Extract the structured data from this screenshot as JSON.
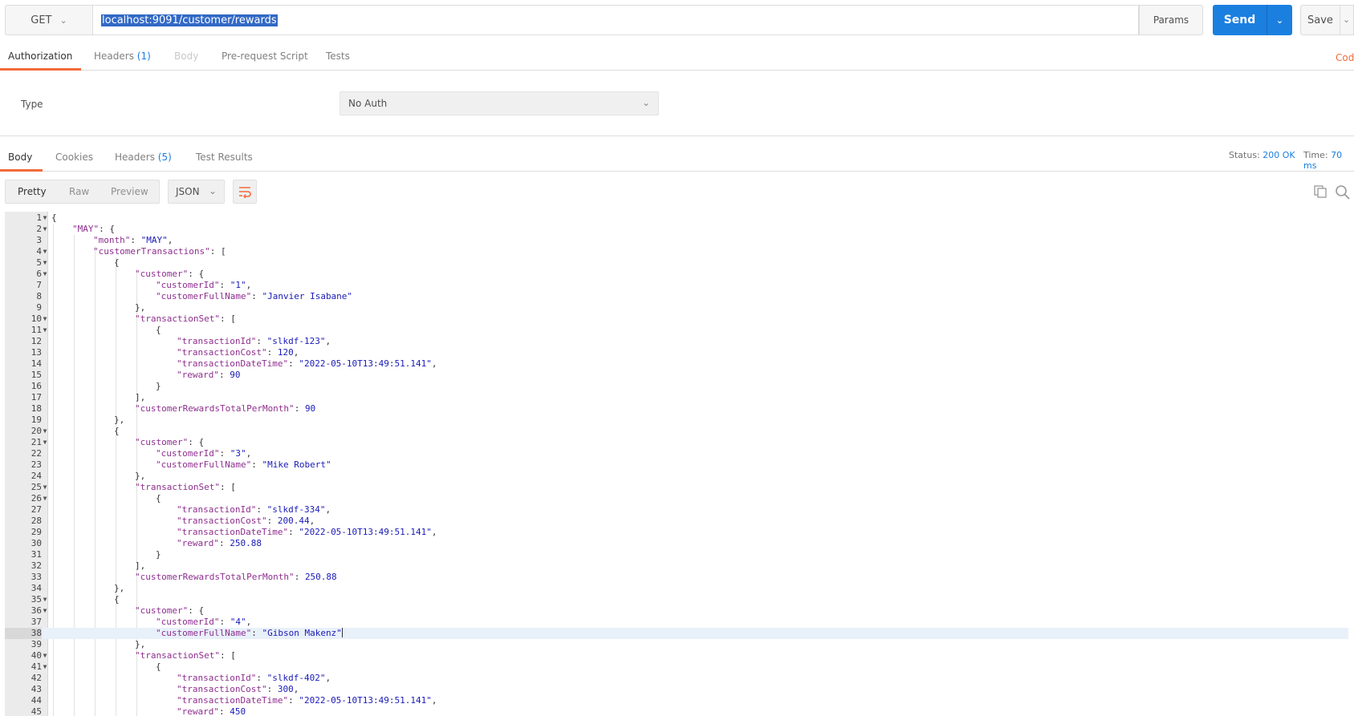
{
  "request": {
    "method": "GET",
    "url": "localhost:9091/customer/rewards",
    "params_label": "Params",
    "send_label": "Send",
    "save_label": "Save"
  },
  "request_tabs": [
    {
      "label": "Authorization",
      "count": ""
    },
    {
      "label": "Headers",
      "count": "(1)"
    },
    {
      "label": "Body",
      "count": ""
    },
    {
      "label": "Pre-request Script",
      "count": ""
    },
    {
      "label": "Tests",
      "count": ""
    }
  ],
  "code_link": "Cod",
  "auth": {
    "type_label": "Type",
    "type_value": "No Auth"
  },
  "response_tabs": [
    {
      "label": "Body",
      "count": ""
    },
    {
      "label": "Cookies",
      "count": ""
    },
    {
      "label": "Headers",
      "count": "(5)"
    },
    {
      "label": "Test Results",
      "count": ""
    }
  ],
  "status": {
    "status_label": "Status:",
    "status_value": "200 OK",
    "time_label": "Time:",
    "time_value": "70 ms"
  },
  "view_modes": [
    "Pretty",
    "Raw",
    "Preview"
  ],
  "format": "JSON",
  "colors": {
    "accent": "#f26b3a",
    "send": "#1b7fe0",
    "key": "#8e2e8e",
    "string": "#1a1ab8"
  },
  "editor": {
    "highlighted_line": 38,
    "lines": [
      {
        "n": 1,
        "fold": true,
        "ind": 0,
        "parts": [
          [
            "p",
            "{"
          ]
        ]
      },
      {
        "n": 2,
        "fold": true,
        "ind": 1,
        "parts": [
          [
            "k",
            "\"MAY\""
          ],
          [
            "p",
            ": {"
          ]
        ]
      },
      {
        "n": 3,
        "fold": false,
        "ind": 2,
        "parts": [
          [
            "k",
            "\"month\""
          ],
          [
            "p",
            ": "
          ],
          [
            "s",
            "\"MAY\""
          ],
          [
            "p",
            ","
          ]
        ]
      },
      {
        "n": 4,
        "fold": true,
        "ind": 2,
        "parts": [
          [
            "k",
            "\"customerTransactions\""
          ],
          [
            "p",
            ": ["
          ]
        ]
      },
      {
        "n": 5,
        "fold": true,
        "ind": 3,
        "parts": [
          [
            "p",
            "{"
          ]
        ]
      },
      {
        "n": 6,
        "fold": true,
        "ind": 4,
        "parts": [
          [
            "k",
            "\"customer\""
          ],
          [
            "p",
            ": {"
          ]
        ]
      },
      {
        "n": 7,
        "fold": false,
        "ind": 5,
        "parts": [
          [
            "k",
            "\"customerId\""
          ],
          [
            "p",
            ": "
          ],
          [
            "s",
            "\"1\""
          ],
          [
            "p",
            ","
          ]
        ]
      },
      {
        "n": 8,
        "fold": false,
        "ind": 5,
        "parts": [
          [
            "k",
            "\"customerFullName\""
          ],
          [
            "p",
            ": "
          ],
          [
            "s",
            "\"Janvier Isabane\""
          ]
        ]
      },
      {
        "n": 9,
        "fold": false,
        "ind": 4,
        "parts": [
          [
            "p",
            "},"
          ]
        ]
      },
      {
        "n": 10,
        "fold": true,
        "ind": 4,
        "parts": [
          [
            "k",
            "\"transactionSet\""
          ],
          [
            "p",
            ": ["
          ]
        ]
      },
      {
        "n": 11,
        "fold": true,
        "ind": 5,
        "parts": [
          [
            "p",
            "{"
          ]
        ]
      },
      {
        "n": 12,
        "fold": false,
        "ind": 6,
        "parts": [
          [
            "k",
            "\"transactionId\""
          ],
          [
            "p",
            ": "
          ],
          [
            "s",
            "\"slkdf-123\""
          ],
          [
            "p",
            ","
          ]
        ]
      },
      {
        "n": 13,
        "fold": false,
        "ind": 6,
        "parts": [
          [
            "k",
            "\"transactionCost\""
          ],
          [
            "p",
            ": "
          ],
          [
            "n",
            "120"
          ],
          [
            "p",
            ","
          ]
        ]
      },
      {
        "n": 14,
        "fold": false,
        "ind": 6,
        "parts": [
          [
            "k",
            "\"transactionDateTime\""
          ],
          [
            "p",
            ": "
          ],
          [
            "s",
            "\"2022-05-10T13:49:51.141\""
          ],
          [
            "p",
            ","
          ]
        ]
      },
      {
        "n": 15,
        "fold": false,
        "ind": 6,
        "parts": [
          [
            "k",
            "\"reward\""
          ],
          [
            "p",
            ": "
          ],
          [
            "n",
            "90"
          ]
        ]
      },
      {
        "n": 16,
        "fold": false,
        "ind": 5,
        "parts": [
          [
            "p",
            "}"
          ]
        ]
      },
      {
        "n": 17,
        "fold": false,
        "ind": 4,
        "parts": [
          [
            "p",
            "],"
          ]
        ]
      },
      {
        "n": 18,
        "fold": false,
        "ind": 4,
        "parts": [
          [
            "k",
            "\"customerRewardsTotalPerMonth\""
          ],
          [
            "p",
            ": "
          ],
          [
            "n",
            "90"
          ]
        ]
      },
      {
        "n": 19,
        "fold": false,
        "ind": 3,
        "parts": [
          [
            "p",
            "},"
          ]
        ]
      },
      {
        "n": 20,
        "fold": true,
        "ind": 3,
        "parts": [
          [
            "p",
            "{"
          ]
        ]
      },
      {
        "n": 21,
        "fold": true,
        "ind": 4,
        "parts": [
          [
            "k",
            "\"customer\""
          ],
          [
            "p",
            ": {"
          ]
        ]
      },
      {
        "n": 22,
        "fold": false,
        "ind": 5,
        "parts": [
          [
            "k",
            "\"customerId\""
          ],
          [
            "p",
            ": "
          ],
          [
            "s",
            "\"3\""
          ],
          [
            "p",
            ","
          ]
        ]
      },
      {
        "n": 23,
        "fold": false,
        "ind": 5,
        "parts": [
          [
            "k",
            "\"customerFullName\""
          ],
          [
            "p",
            ": "
          ],
          [
            "s",
            "\"Mike Robert\""
          ]
        ]
      },
      {
        "n": 24,
        "fold": false,
        "ind": 4,
        "parts": [
          [
            "p",
            "},"
          ]
        ]
      },
      {
        "n": 25,
        "fold": true,
        "ind": 4,
        "parts": [
          [
            "k",
            "\"transactionSet\""
          ],
          [
            "p",
            ": ["
          ]
        ]
      },
      {
        "n": 26,
        "fold": true,
        "ind": 5,
        "parts": [
          [
            "p",
            "{"
          ]
        ]
      },
      {
        "n": 27,
        "fold": false,
        "ind": 6,
        "parts": [
          [
            "k",
            "\"transactionId\""
          ],
          [
            "p",
            ": "
          ],
          [
            "s",
            "\"slkdf-334\""
          ],
          [
            "p",
            ","
          ]
        ]
      },
      {
        "n": 28,
        "fold": false,
        "ind": 6,
        "parts": [
          [
            "k",
            "\"transactionCost\""
          ],
          [
            "p",
            ": "
          ],
          [
            "n",
            "200.44"
          ],
          [
            "p",
            ","
          ]
        ]
      },
      {
        "n": 29,
        "fold": false,
        "ind": 6,
        "parts": [
          [
            "k",
            "\"transactionDateTime\""
          ],
          [
            "p",
            ": "
          ],
          [
            "s",
            "\"2022-05-10T13:49:51.141\""
          ],
          [
            "p",
            ","
          ]
        ]
      },
      {
        "n": 30,
        "fold": false,
        "ind": 6,
        "parts": [
          [
            "k",
            "\"reward\""
          ],
          [
            "p",
            ": "
          ],
          [
            "n",
            "250.88"
          ]
        ]
      },
      {
        "n": 31,
        "fold": false,
        "ind": 5,
        "parts": [
          [
            "p",
            "}"
          ]
        ]
      },
      {
        "n": 32,
        "fold": false,
        "ind": 4,
        "parts": [
          [
            "p",
            "],"
          ]
        ]
      },
      {
        "n": 33,
        "fold": false,
        "ind": 4,
        "parts": [
          [
            "k",
            "\"customerRewardsTotalPerMonth\""
          ],
          [
            "p",
            ": "
          ],
          [
            "n",
            "250.88"
          ]
        ]
      },
      {
        "n": 34,
        "fold": false,
        "ind": 3,
        "parts": [
          [
            "p",
            "},"
          ]
        ]
      },
      {
        "n": 35,
        "fold": true,
        "ind": 3,
        "parts": [
          [
            "p",
            "{"
          ]
        ]
      },
      {
        "n": 36,
        "fold": true,
        "ind": 4,
        "parts": [
          [
            "k",
            "\"customer\""
          ],
          [
            "p",
            ": {"
          ]
        ]
      },
      {
        "n": 37,
        "fold": false,
        "ind": 5,
        "parts": [
          [
            "k",
            "\"customerId\""
          ],
          [
            "p",
            ": "
          ],
          [
            "s",
            "\"4\""
          ],
          [
            "p",
            ","
          ]
        ]
      },
      {
        "n": 38,
        "fold": false,
        "ind": 5,
        "parts": [
          [
            "k",
            "\"customerFullName\""
          ],
          [
            "p",
            ": "
          ],
          [
            "s",
            "\"Gibson Makenz\""
          ]
        ]
      },
      {
        "n": 39,
        "fold": false,
        "ind": 4,
        "parts": [
          [
            "p",
            "},"
          ]
        ]
      },
      {
        "n": 40,
        "fold": true,
        "ind": 4,
        "parts": [
          [
            "k",
            "\"transactionSet\""
          ],
          [
            "p",
            ": ["
          ]
        ]
      },
      {
        "n": 41,
        "fold": true,
        "ind": 5,
        "parts": [
          [
            "p",
            "{"
          ]
        ]
      },
      {
        "n": 42,
        "fold": false,
        "ind": 6,
        "parts": [
          [
            "k",
            "\"transactionId\""
          ],
          [
            "p",
            ": "
          ],
          [
            "s",
            "\"slkdf-402\""
          ],
          [
            "p",
            ","
          ]
        ]
      },
      {
        "n": 43,
        "fold": false,
        "ind": 6,
        "parts": [
          [
            "k",
            "\"transactionCost\""
          ],
          [
            "p",
            ": "
          ],
          [
            "n",
            "300"
          ],
          [
            "p",
            ","
          ]
        ]
      },
      {
        "n": 44,
        "fold": false,
        "ind": 6,
        "parts": [
          [
            "k",
            "\"transactionDateTime\""
          ],
          [
            "p",
            ": "
          ],
          [
            "s",
            "\"2022-05-10T13:49:51.141\""
          ],
          [
            "p",
            ","
          ]
        ]
      },
      {
        "n": 45,
        "fold": false,
        "ind": 6,
        "parts": [
          [
            "k",
            "\"reward\""
          ],
          [
            "p",
            ": "
          ],
          [
            "n",
            "450"
          ]
        ]
      }
    ]
  }
}
